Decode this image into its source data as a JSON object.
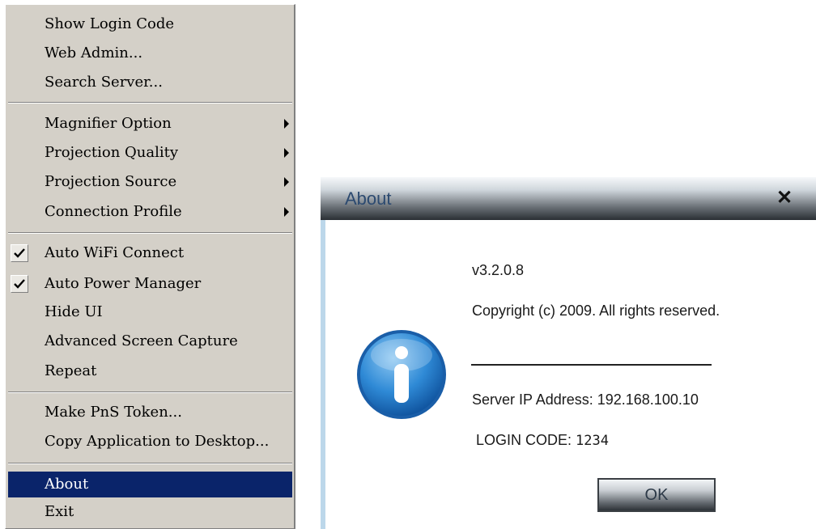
{
  "context_menu": {
    "items": [
      {
        "label": "Show Login Code"
      },
      {
        "label": "Web Admin..."
      },
      {
        "label": "Search Server..."
      },
      {
        "label": "Magnifier Option",
        "submenu": true
      },
      {
        "label": "Projection Quality",
        "submenu": true
      },
      {
        "label": "Projection Source",
        "submenu": true
      },
      {
        "label": "Connection Profile",
        "submenu": true
      },
      {
        "label": "Auto WiFi Connect",
        "checked": true
      },
      {
        "label": "Auto Power Manager",
        "checked": true
      },
      {
        "label": "Hide UI"
      },
      {
        "label": "Advanced Screen Capture"
      },
      {
        "label": "Repeat"
      },
      {
        "label": "Make PnS Token..."
      },
      {
        "label": "Copy Application to Desktop..."
      },
      {
        "label": "About",
        "selected": true
      },
      {
        "label": "Exit"
      }
    ],
    "selection_color": "#0a246a"
  },
  "about_dialog": {
    "title": "About",
    "close_icon": "close-icon",
    "version": "v3.2.0.8",
    "copyright": "Copyright (c) 2009. All rights reserved.",
    "server_ip_label": "Server IP Address: 192.168.100.10",
    "login_code_label": "LOGIN CODE:",
    "login_code_value": "1234",
    "ok_label": "OK",
    "icon": "info-icon"
  }
}
